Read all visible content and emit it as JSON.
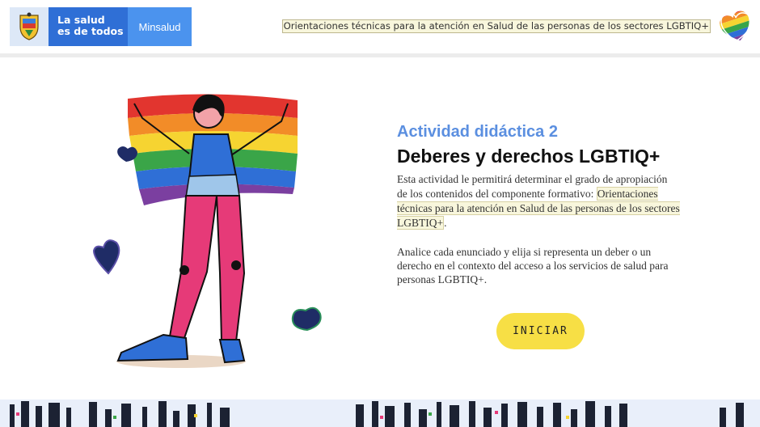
{
  "header": {
    "shield_icon": "colombia-coat-of-arms-icon",
    "slogan_line1": "La salud",
    "slogan_line2": "es de todos",
    "ministry": "Minsalud",
    "title": "Orientaciones técnicas para la atención en Salud de las personas de los sectores LGBTIQ+",
    "logo_icon": "rainbow-heart-icon"
  },
  "illustration": {
    "icon": "person-holding-rainbow-flag-illustration"
  },
  "activity": {
    "label": "Actividad didáctica 2",
    "title": "Deberes y derechos LGBTIQ+",
    "description_intro": "Esta actividad le permitirá determinar el grado de apropiación de los contenidos del componente formativo: ",
    "description_highlight": "Orientaciones técnicas para la atención en Salud de las personas de los sectores LGBTIQ+",
    "description_end": ".",
    "instructions": "Analice cada enunciado y elija si representa un deber o un derecho en el contexto del acceso a los servicios de salud para personas LGBTIQ+.",
    "start_button": "INICIAR"
  },
  "colors": {
    "brand_blue": "#2f6fd6",
    "minsalud_blue": "#4b93ee",
    "activity_label": "#5b8fe0",
    "button_yellow": "#f7df45"
  }
}
